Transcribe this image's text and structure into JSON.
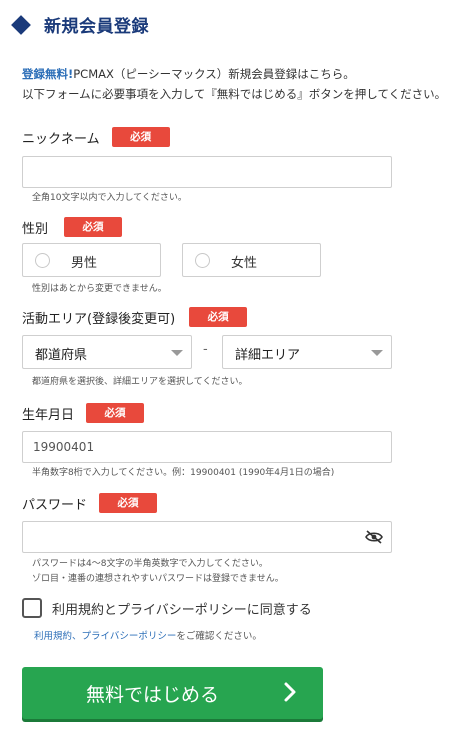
{
  "title": "新規会員登録",
  "intro": {
    "accent": "登録無料!",
    "line1_rest": "PCMAX（ピーシーマックス）新規会員登録はこちら。",
    "line2": "以下フォームに必要事項を入力して『無料ではじめる』ボタンを押してください。"
  },
  "required_badge": "必須",
  "fields": {
    "nickname": {
      "label": "ニックネーム",
      "value": "",
      "help": "全角10文字以内で入力してください。"
    },
    "gender": {
      "label": "性別",
      "options": [
        "男性",
        "女性"
      ],
      "help": "性別はあとから変更できません。"
    },
    "area": {
      "label": "活動エリア(登録後変更可)",
      "prefecture": "都道府県",
      "separator": "-",
      "detail": "詳細エリア",
      "help": "都道府県を選択後、詳細エリアを選択してください。"
    },
    "birthdate": {
      "label": "生年月日",
      "value": "19900401",
      "help": "半角数字8桁で入力してください。例：19900401 (1990年4月1日の場合)"
    },
    "password": {
      "label": "パスワード",
      "value": "",
      "help_line1": "パスワードは4～8文字の半角英数字で入力してください。",
      "help_line2": "ゾロ目・連番の連想されやすいパスワードは登録できません。"
    }
  },
  "agreement": {
    "label": "利用規約とプライバシーポリシーに同意する",
    "checked": false,
    "terms_link": "利用規約",
    "separator": "、",
    "privacy_link": "プライバシーポリシー",
    "confirm_text": "をご確認ください。"
  },
  "submit_label": "無料ではじめる",
  "colors": {
    "accent": "#1a3a7a",
    "link": "#2d6fb8",
    "required": "#e8493c",
    "submit": "#27a550"
  }
}
